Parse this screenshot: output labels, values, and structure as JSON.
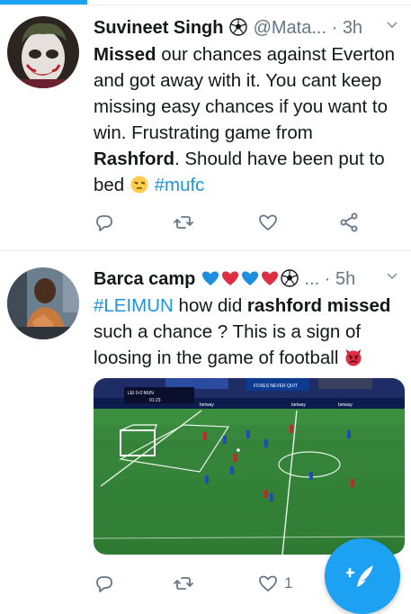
{
  "tweets": [
    {
      "name": "Suvineet Singh",
      "handle": "@Mata...",
      "time": "3h",
      "body_parts": {
        "p1": "Missed",
        "p2": " our chances against Everton and got away with it. You cant keep missing easy chances if you want to win. Frustrating game from ",
        "p3": "Rashford",
        "p4": ". Should have been put to bed ",
        "hashtag": "#mufc"
      },
      "actions": {
        "reply_count": "",
        "retweet_count": "",
        "like_count": ""
      }
    },
    {
      "name": "Barca camp",
      "handle": "...",
      "time": "5h",
      "body_parts": {
        "hashtag": "#LEIMUN",
        "p1": " how did ",
        "p2": "rashford missed",
        "p3": " such a chance ? This is a sign of loosing in the game of football "
      },
      "media": {
        "scoreboard_teams": "LEI 0-0 MUN",
        "scoreboard_time": "01:23",
        "ad_boards": [
          "betway",
          "betway",
          "betway",
          "FOXES NEVER QUIT"
        ]
      },
      "actions": {
        "reply_count": "",
        "retweet_count": "",
        "like_count": "1"
      }
    }
  ],
  "icons": {
    "reply": "reply-icon",
    "retweet": "retweet-icon",
    "like": "heart-icon",
    "share": "share-icon",
    "compose": "compose-tweet-icon",
    "more": "chevron-down-icon"
  },
  "colors": {
    "accent": "#1da1f2",
    "hashtag": "#1b95e0",
    "muted": "#657786",
    "text": "#14171a"
  }
}
